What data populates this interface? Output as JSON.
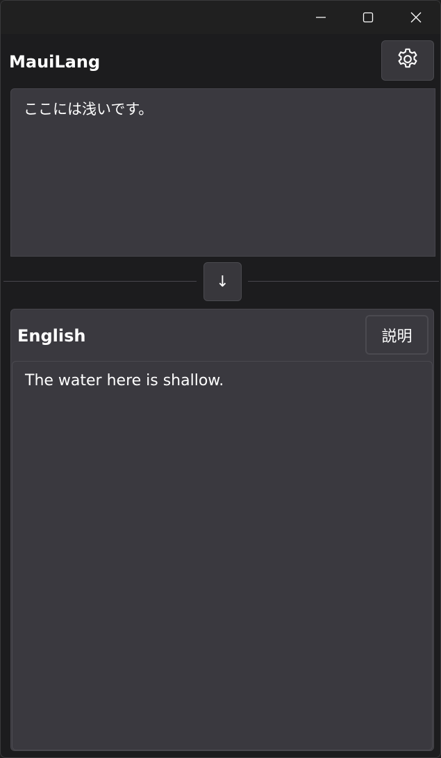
{
  "window": {
    "minimize_icon": "minimize-icon",
    "maximize_icon": "maximize-icon",
    "close_icon": "close-icon"
  },
  "header": {
    "title": "MauiLang",
    "settings_icon": "gear-icon"
  },
  "source": {
    "text": "ここには浅いです。"
  },
  "swap": {
    "label": "↓"
  },
  "result": {
    "language": "English",
    "explain_label": "説明",
    "text": "The water here is shallow."
  },
  "colors": {
    "background": "#1c1c1e",
    "panel": "#3a393f",
    "border": "#4a4a4f",
    "text": "#ffffff"
  }
}
